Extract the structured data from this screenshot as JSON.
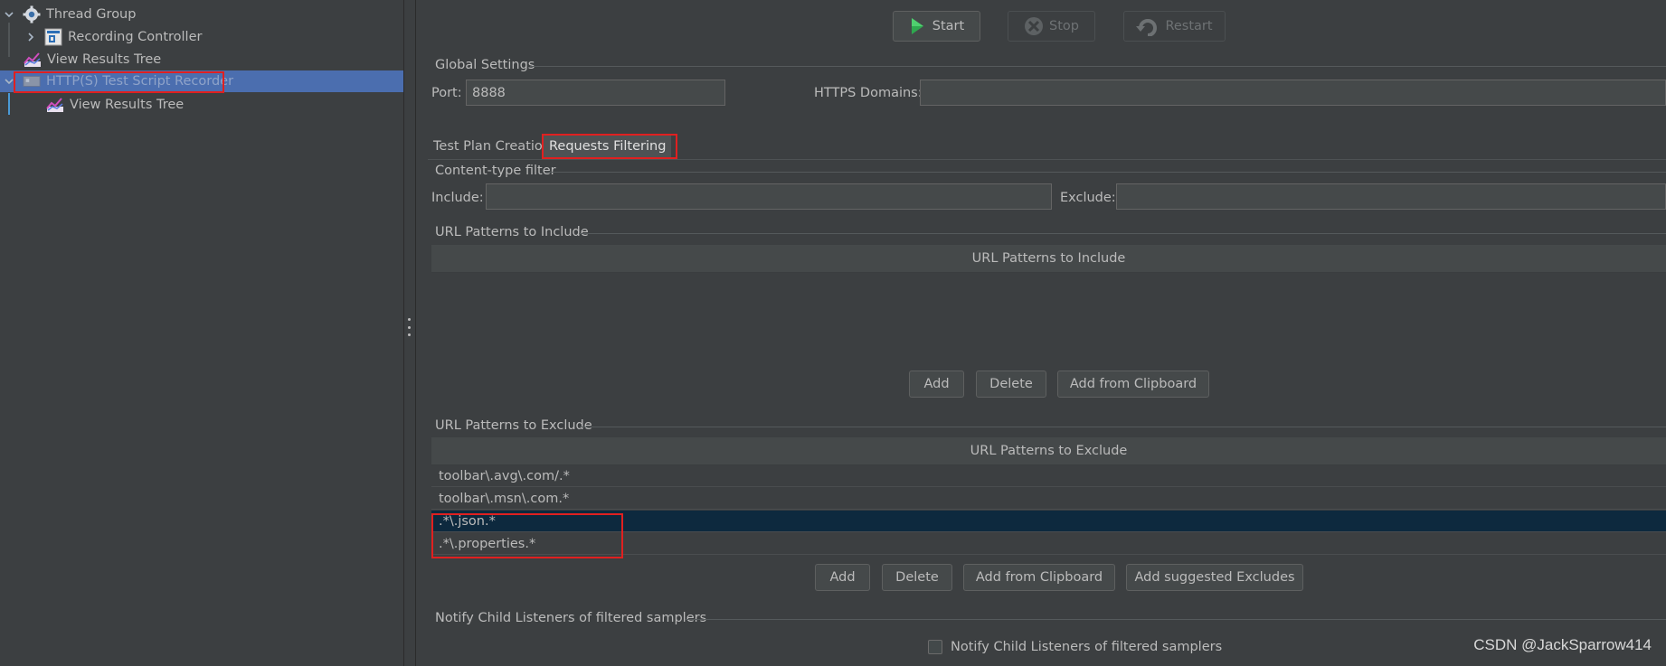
{
  "tree": {
    "items": [
      {
        "label": "Thread Group",
        "icon": "gear-icon"
      },
      {
        "label": "Recording Controller",
        "icon": "controller-icon"
      },
      {
        "label": "View Results Tree",
        "icon": "listener-chart-icon"
      },
      {
        "label": "HTTP(S) Test Script Recorder",
        "icon": "recorder-icon"
      },
      {
        "label": "View Results Tree",
        "icon": "listener-chart-icon"
      }
    ]
  },
  "toolbar": {
    "start_label": "Start",
    "stop_label": "Stop",
    "restart_label": "Restart"
  },
  "global_settings": {
    "title": "Global Settings",
    "port_label": "Port:",
    "port_value": "8888",
    "https_domains_label": "HTTPS Domains:",
    "https_domains_value": ""
  },
  "tabs": [
    {
      "label": "Test Plan Creation"
    },
    {
      "label": "Requests Filtering"
    }
  ],
  "content_type_filter": {
    "title": "Content-type filter",
    "include_label": "Include:",
    "include_value": "",
    "exclude_label": "Exclude:",
    "exclude_value": ""
  },
  "include_patterns": {
    "title": "URL Patterns to Include",
    "column_header": "URL Patterns to Include",
    "rows": [],
    "buttons": {
      "add": "Add",
      "delete": "Delete",
      "add_from_clipboard": "Add from Clipboard"
    }
  },
  "exclude_patterns": {
    "title": "URL Patterns to Exclude",
    "column_header": "URL Patterns to Exclude",
    "rows": [
      "toolbar\\.avg\\.com/.*",
      "toolbar\\.msn\\.com.*",
      ".*\\.json.*",
      ".*\\.properties.*"
    ],
    "buttons": {
      "add": "Add",
      "delete": "Delete",
      "add_from_clipboard": "Add from Clipboard",
      "add_suggested": "Add suggested Excludes"
    }
  },
  "notify": {
    "title": "Notify Child Listeners of filtered samplers",
    "checkbox_label": "Notify Child Listeners of filtered samplers",
    "checked": false
  },
  "watermark": "CSDN @JackSparrow414",
  "colors": {
    "background": "#3c3f41",
    "selection": "#4b6eaf",
    "table_selection": "#0d293e",
    "highlight": "#e02020",
    "start_icon": "#2fa84f"
  }
}
